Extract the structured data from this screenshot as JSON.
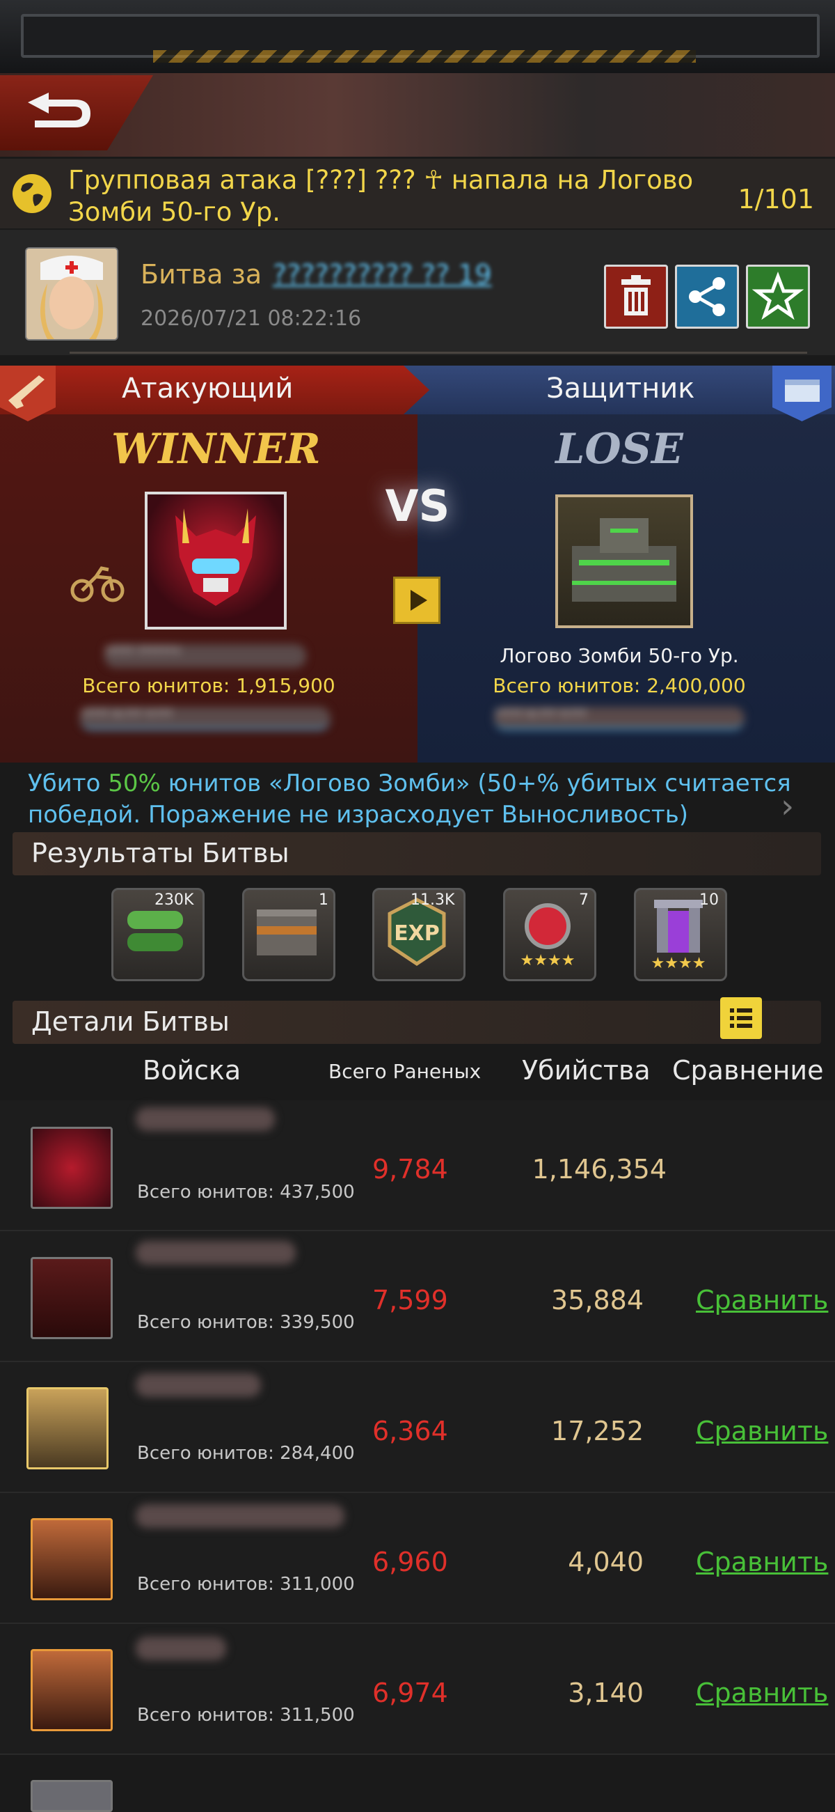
{
  "notification": {
    "text": "Групповая атака [???] ??? ☥ напала на Логово Зомби 50-го Ур.",
    "count": "1/101"
  },
  "battle": {
    "title": "Битва за",
    "title_link": "?????????? ?? 19",
    "date": "2026/07/21 08:22:16",
    "delete_icon": "trash-icon",
    "share_icon": "share-icon",
    "favorite_icon": "star-icon"
  },
  "attacker": {
    "tab_label": "Атакующий",
    "result": "WINNER",
    "name": "????? ??????☥",
    "units": "Всего юнитов: 1,915,900",
    "coords": "????? X:??? Y:???"
  },
  "defender": {
    "tab_label": "Защитник",
    "result": "LOSE",
    "name": "Логово Зомби 50-го Ур.",
    "units": "Всего юнитов: 2,400,000",
    "coords": "????? X:??? Y:???"
  },
  "vs_label": "VS",
  "message": {
    "prefix": "Убито ",
    "percent": "50%",
    "suffix": " юнитов «Логово Зомби» (50+% убитых считается победой. Поражение не израсходует Выносливость)"
  },
  "results": {
    "title": "Результаты Битвы",
    "rewards": [
      {
        "icon": "green-batteries-icon",
        "count": "230K"
      },
      {
        "icon": "metal-crate-icon",
        "count": "1"
      },
      {
        "icon": "exp-badge-icon",
        "count": "11.3K"
      },
      {
        "icon": "red-orb-icon",
        "count": "7"
      },
      {
        "icon": "purple-portal-icon",
        "count": "10"
      }
    ]
  },
  "details": {
    "title": "Детали Битвы",
    "columns": {
      "troops": "Войска",
      "wounded": "Всего Раненых",
      "kills": "Убийства",
      "compare": "Сравнение"
    },
    "rows": [
      {
        "units": "Всего юнитов: 437,500",
        "wounded": "9,784",
        "kills": "1,146,354",
        "compare": ""
      },
      {
        "units": "Всего юнитов: 339,500",
        "wounded": "7,599",
        "kills": "35,884",
        "compare": "Сравнить"
      },
      {
        "units": "Всего юнитов: 284,400",
        "wounded": "6,364",
        "kills": "17,252",
        "compare": "Сравнить"
      },
      {
        "units": "Всего юнитов: 311,000",
        "wounded": "6,960",
        "kills": "4,040",
        "compare": "Сравнить"
      },
      {
        "units": "Всего юнитов: 311,500",
        "wounded": "6,974",
        "kills": "3,140",
        "compare": "Сравнить"
      }
    ]
  },
  "colors": {
    "gold": "#f2d64a",
    "link": "#5fc0ee",
    "wounded": "#e0302a",
    "compare": "#48c038"
  }
}
